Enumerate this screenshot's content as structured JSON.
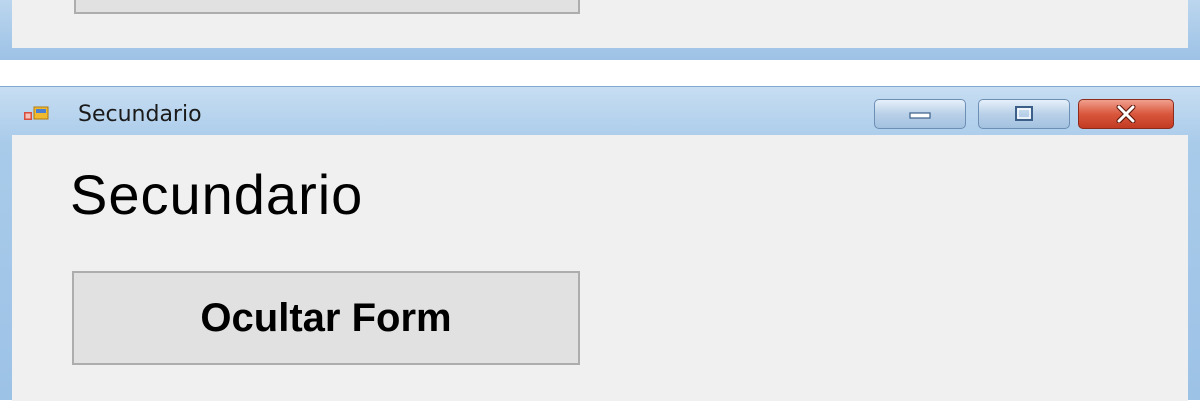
{
  "window": {
    "title": "Secundario",
    "app_icon": "winforms-app-icon",
    "controls": {
      "minimize_icon": "minimize-icon",
      "maximize_icon": "maximize-icon",
      "close_icon": "close-icon"
    }
  },
  "form": {
    "heading": "Secundario",
    "hide_button_label": "Ocultar Form"
  },
  "colors": {
    "frame": "#9cc2e6",
    "client": "#f0f0f0",
    "button_face": "#e1e1e1",
    "close_button": "#d9573d"
  }
}
